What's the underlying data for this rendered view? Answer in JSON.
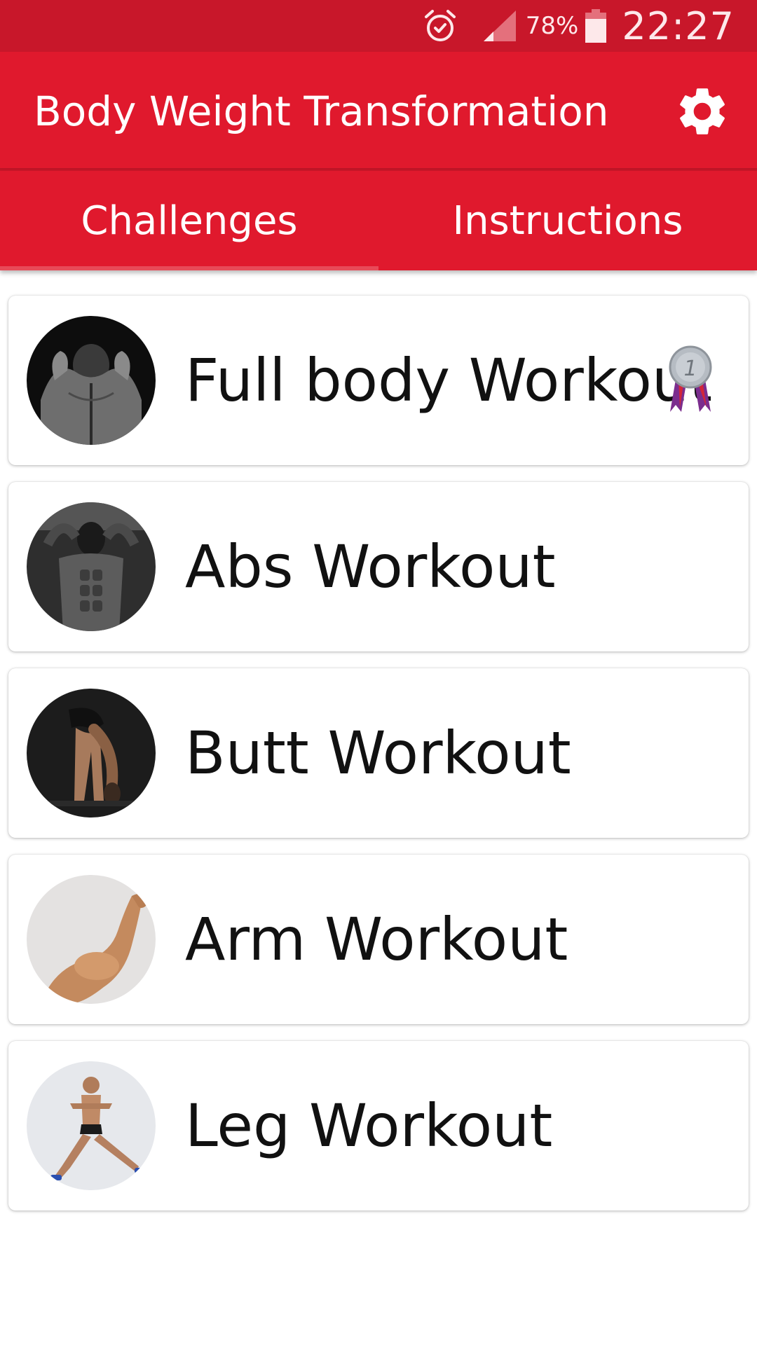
{
  "status_bar": {
    "battery_percent": "78%",
    "time": "22:27",
    "icons": [
      "alarm-icon",
      "signal-icon",
      "battery-icon"
    ]
  },
  "app_bar": {
    "title": "Body Weight Transformation",
    "settings_icon": "gear-icon"
  },
  "tabs": [
    {
      "label": "Challenges",
      "active": true
    },
    {
      "label": "Instructions",
      "active": false
    }
  ],
  "workouts": [
    {
      "label": "Full body Workout",
      "thumbnail": "back-muscles-photo",
      "badge": "1"
    },
    {
      "label": "Abs Workout",
      "thumbnail": "abs-photo"
    },
    {
      "label": "Butt Workout",
      "thumbnail": "forward-bend-photo"
    },
    {
      "label": "Arm Workout",
      "thumbnail": "bicep-photo"
    },
    {
      "label": "Leg Workout",
      "thumbnail": "side-lunge-photo"
    }
  ],
  "colors": {
    "status_bar": "#c8172a",
    "primary": "#e0192d",
    "tab_indicator": "#e84a58",
    "text": "#111111"
  }
}
